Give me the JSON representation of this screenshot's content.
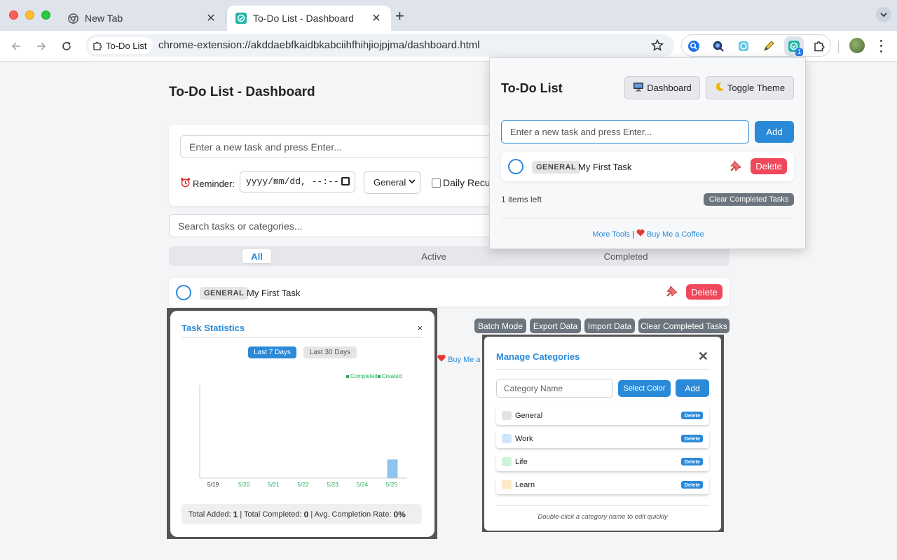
{
  "browser": {
    "tabs": [
      {
        "title": "New Tab",
        "icon": "chrome-icon"
      },
      {
        "title": "To-Do List - Dashboard",
        "icon": "todo-extension-icon",
        "active": true
      }
    ],
    "site_chip": "To-Do List",
    "url": "chrome-extension://akddaebfkaidbkabciihfhihjiojpjma/dashboard.html",
    "extension_badge": "1"
  },
  "dashboard": {
    "title": "To-Do List - Dashboard",
    "task_input_placeholder": "Enter a new task and press Enter...",
    "reminder_label": "Reminder:",
    "reminder_value": "yyyy/mm/dd, --:--",
    "category_selected": "General",
    "daily_label": "Daily Recur",
    "search_placeholder": "Search tasks or categories...",
    "filters": [
      "All",
      "Active",
      "Completed"
    ],
    "active_filter": "All",
    "tasks": [
      {
        "category": "GENERAL",
        "text": "My First Task"
      }
    ],
    "delete_label": "Delete",
    "actions": [
      "Batch Mode",
      "Export Data",
      "Import Data",
      "Clear Completed Tasks"
    ],
    "buy_partial": "Buy Me a"
  },
  "stats": {
    "title": "Task Statistics",
    "close": "×",
    "ranges": [
      "Last 7 Days",
      "Last 30 Days"
    ],
    "legend": [
      "Completed",
      "Created"
    ],
    "footer": {
      "added_label": "Total Added:",
      "added": "1",
      "completed_label": "| Total Completed:",
      "completed": "0",
      "rate_label": "| Avg. Completion Rate:",
      "rate": "0%"
    }
  },
  "chart_data": {
    "type": "bar",
    "categories": [
      "5/19",
      "5/20",
      "5/21",
      "5/22",
      "5/23",
      "5/24",
      "5/25"
    ],
    "series": [
      {
        "name": "Completed",
        "values": [
          0,
          0,
          0,
          0,
          0,
          0,
          0
        ],
        "color": "#27ae60"
      },
      {
        "name": "Created",
        "values": [
          0,
          0,
          0,
          0,
          0,
          0,
          1
        ],
        "color": "#90c4ee"
      }
    ],
    "ylim": [
      0,
      5
    ]
  },
  "categories_modal": {
    "title": "Manage Categories",
    "close": "✕",
    "name_placeholder": "Category Name",
    "select_color": "Select Color",
    "add": "Add",
    "items": [
      {
        "name": "General",
        "color": "#e2e2e2"
      },
      {
        "name": "Work",
        "color": "#cfe6fb"
      },
      {
        "name": "Life",
        "color": "#cdf3d9"
      },
      {
        "name": "Learn",
        "color": "#fde9c4"
      }
    ],
    "delete_label": "Delete",
    "hint": "Double-click a category name to edit quickly"
  },
  "popup": {
    "title": "To-Do List",
    "dashboard_btn": "Dashboard",
    "theme_btn": "Toggle Theme",
    "input_placeholder": "Enter a new task and press Enter...",
    "add": "Add",
    "task": {
      "category": "GENERAL",
      "text": "My First Task"
    },
    "delete": "Delete",
    "items_left": "1 items left",
    "clear": "Clear Completed Tasks",
    "more_tools": "More Tools",
    "separator": "|",
    "buy_coffee": "Buy Me a Coffee"
  }
}
